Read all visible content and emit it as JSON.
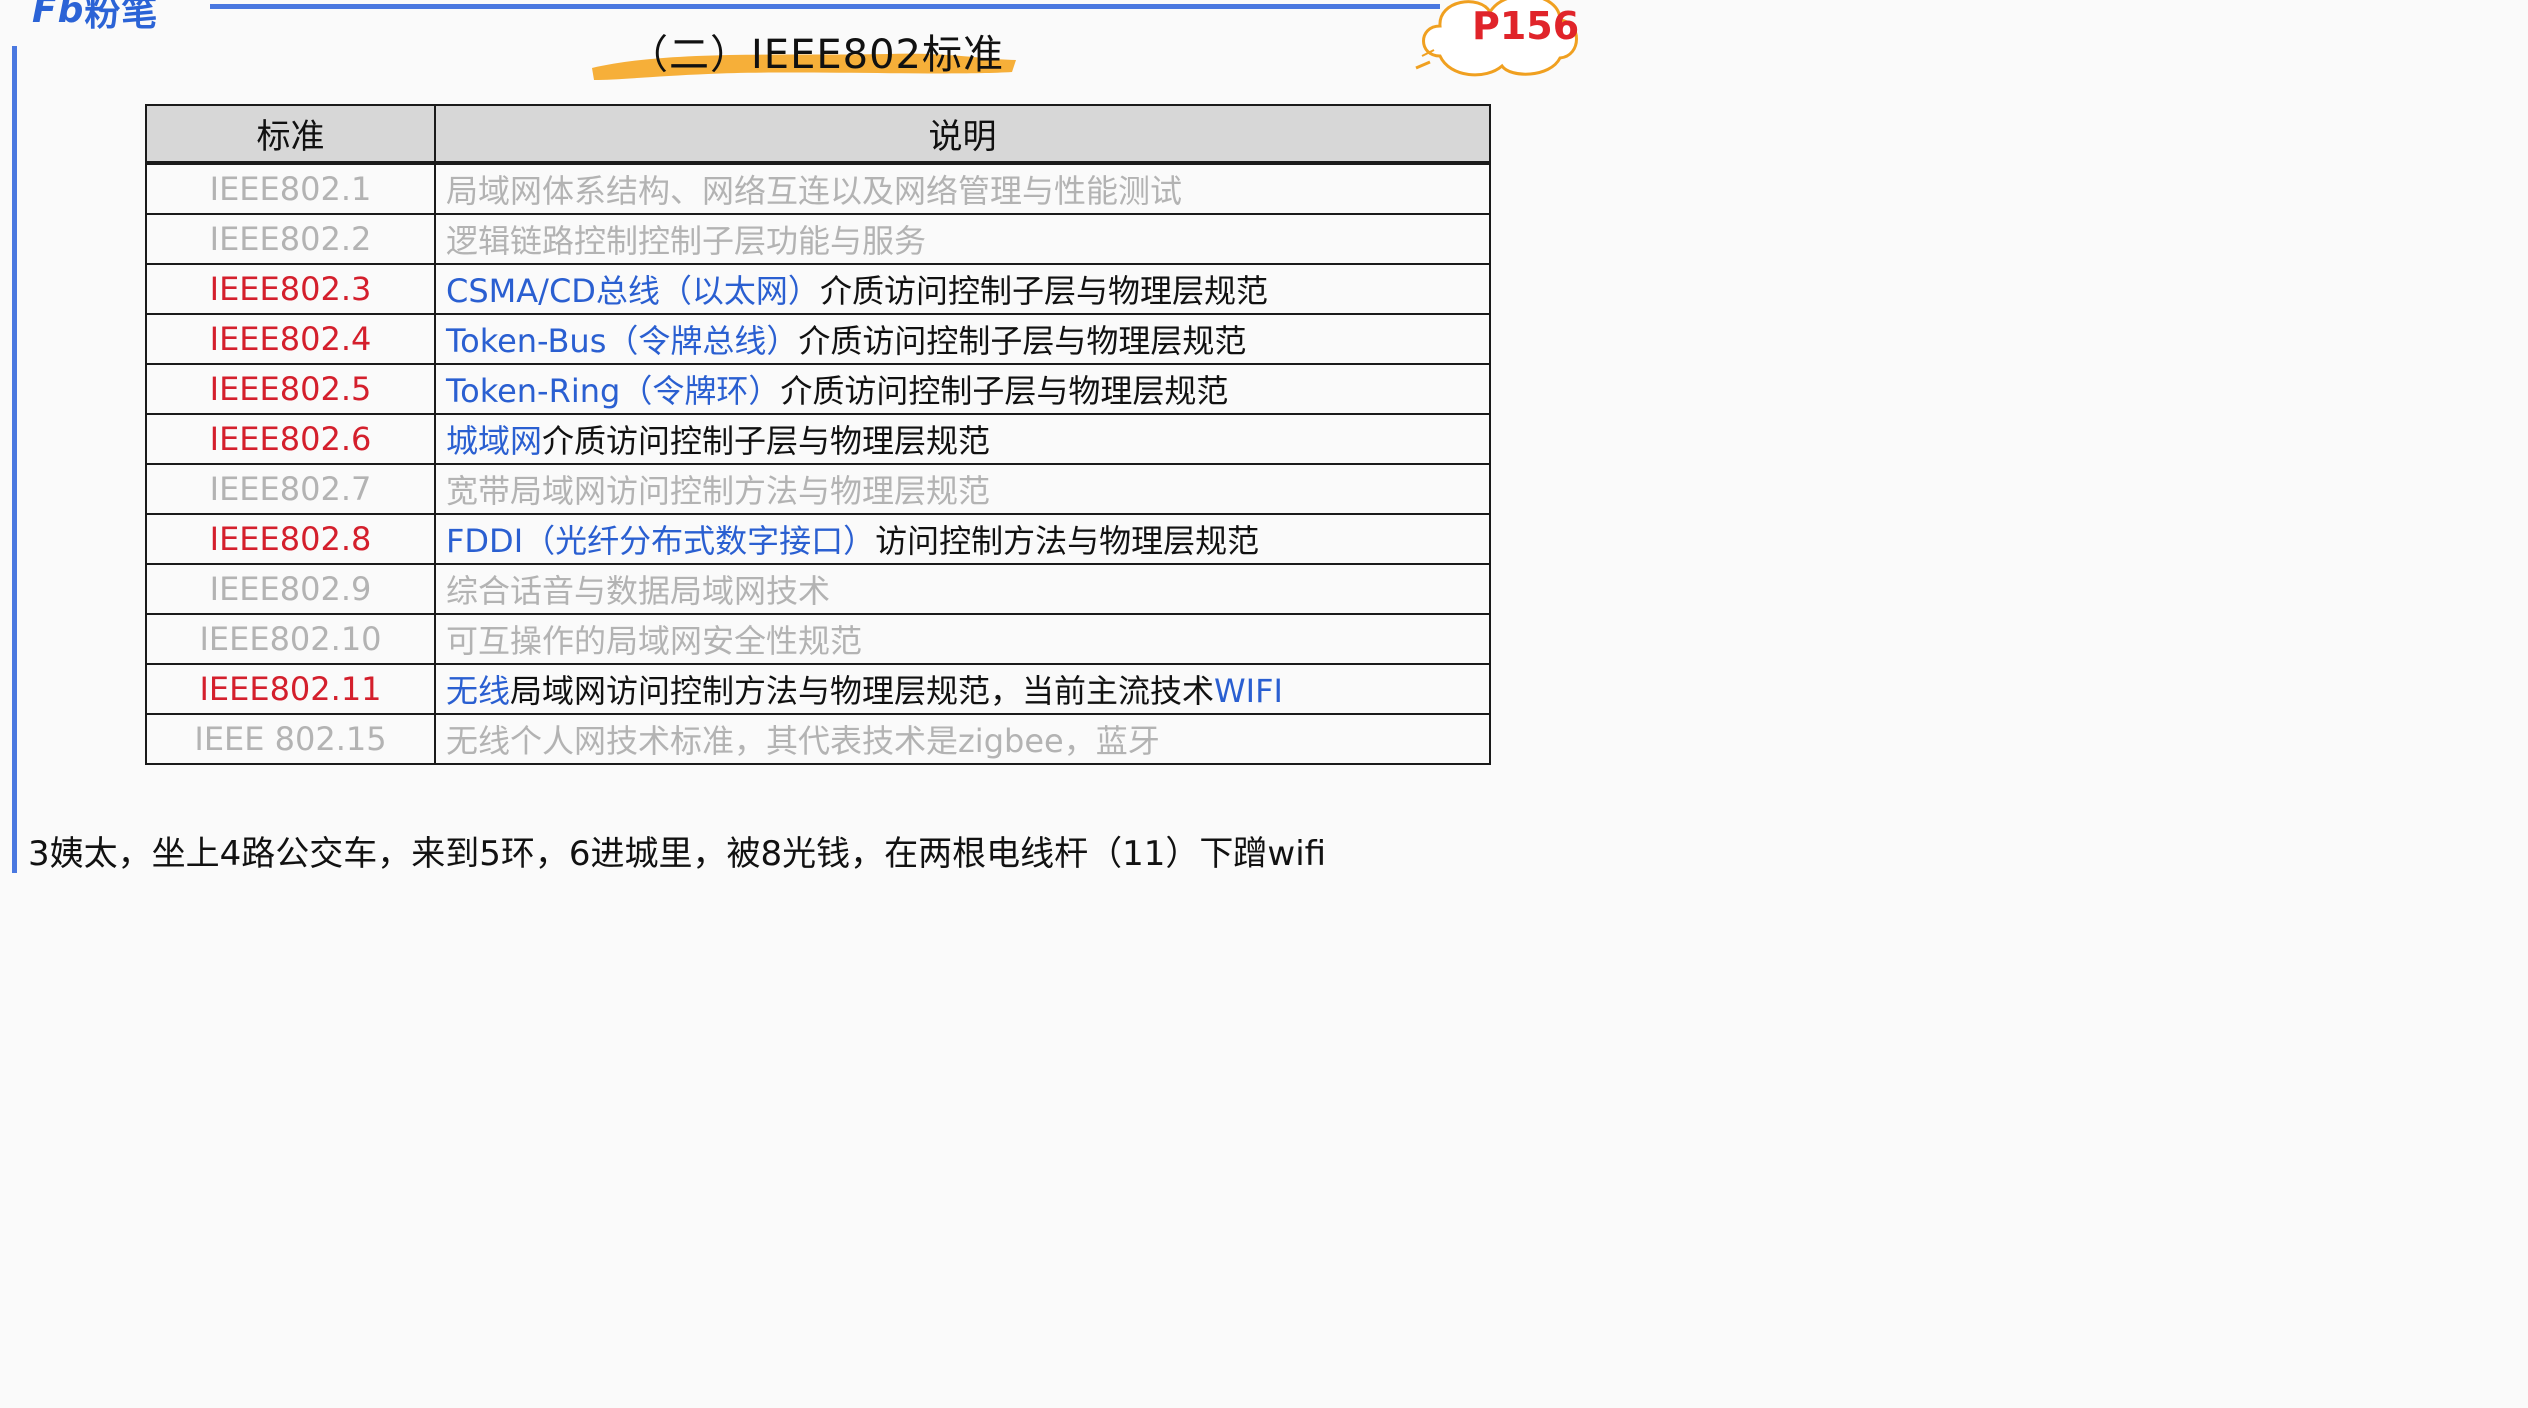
{
  "logo": {
    "mark": "Fb",
    "name": "粉笔"
  },
  "title": "（二）IEEE802标准",
  "page_number": "P156",
  "colors": {
    "accent_blue": "#4a78e0",
    "highlight_orange": "#f5a623",
    "red": "#d41f2c",
    "link_blue": "#2a5fd1",
    "grey_text": "#b3b3b3"
  },
  "table": {
    "headers": [
      "标准",
      "说明"
    ],
    "rows": [
      {
        "standard": "IEEE802.1",
        "desc_blue": "",
        "desc_rest": "局域网体系结构、网络互连以及网络管理与性能测试",
        "highlight": false
      },
      {
        "standard": "IEEE802.2",
        "desc_blue": "",
        "desc_rest": "逻辑链路控制控制子层功能与服务",
        "highlight": false
      },
      {
        "standard": "IEEE802.3",
        "desc_blue": "CSMA/CD总线（以太网）",
        "desc_rest": "介质访问控制子层与物理层规范",
        "highlight": true
      },
      {
        "standard": "IEEE802.4",
        "desc_blue": "Token-Bus（令牌总线）",
        "desc_rest": "介质访问控制子层与物理层规范",
        "highlight": true
      },
      {
        "standard": "IEEE802.5",
        "desc_blue": "Token-Ring（令牌环）",
        "desc_rest": "介质访问控制子层与物理层规范",
        "highlight": true
      },
      {
        "standard": "IEEE802.6",
        "desc_blue": "城域网",
        "desc_rest": "介质访问控制子层与物理层规范",
        "highlight": true
      },
      {
        "standard": "IEEE802.7",
        "desc_blue": "",
        "desc_rest": "宽带局域网访问控制方法与物理层规范",
        "highlight": false
      },
      {
        "standard": "IEEE802.8",
        "desc_blue": "FDDI（光纤分布式数字接口）",
        "desc_rest": "访问控制方法与物理层规范",
        "highlight": true
      },
      {
        "standard": "IEEE802.9",
        "desc_blue": "",
        "desc_rest": "综合话音与数据局域网技术",
        "highlight": false
      },
      {
        "standard": "IEEE802.10",
        "desc_blue": "",
        "desc_rest": "可互操作的局域网安全性规范",
        "highlight": false
      },
      {
        "standard": "IEEE802.11",
        "desc_blue": "无线",
        "desc_rest": "局域网访问控制方法与物理层规范，当前主流技术",
        "desc_tail": "WIFI",
        "highlight": true
      },
      {
        "standard": "IEEE 802.15",
        "desc_blue": "",
        "desc_rest": "无线个人网技术标准，其代表技术是zigbee，蓝牙",
        "highlight": false
      }
    ]
  },
  "mnemonic": "3姨太，坐上4路公交车，来到5环，6进城里，被8光钱，在两根电线杆（11）下蹭wifi"
}
